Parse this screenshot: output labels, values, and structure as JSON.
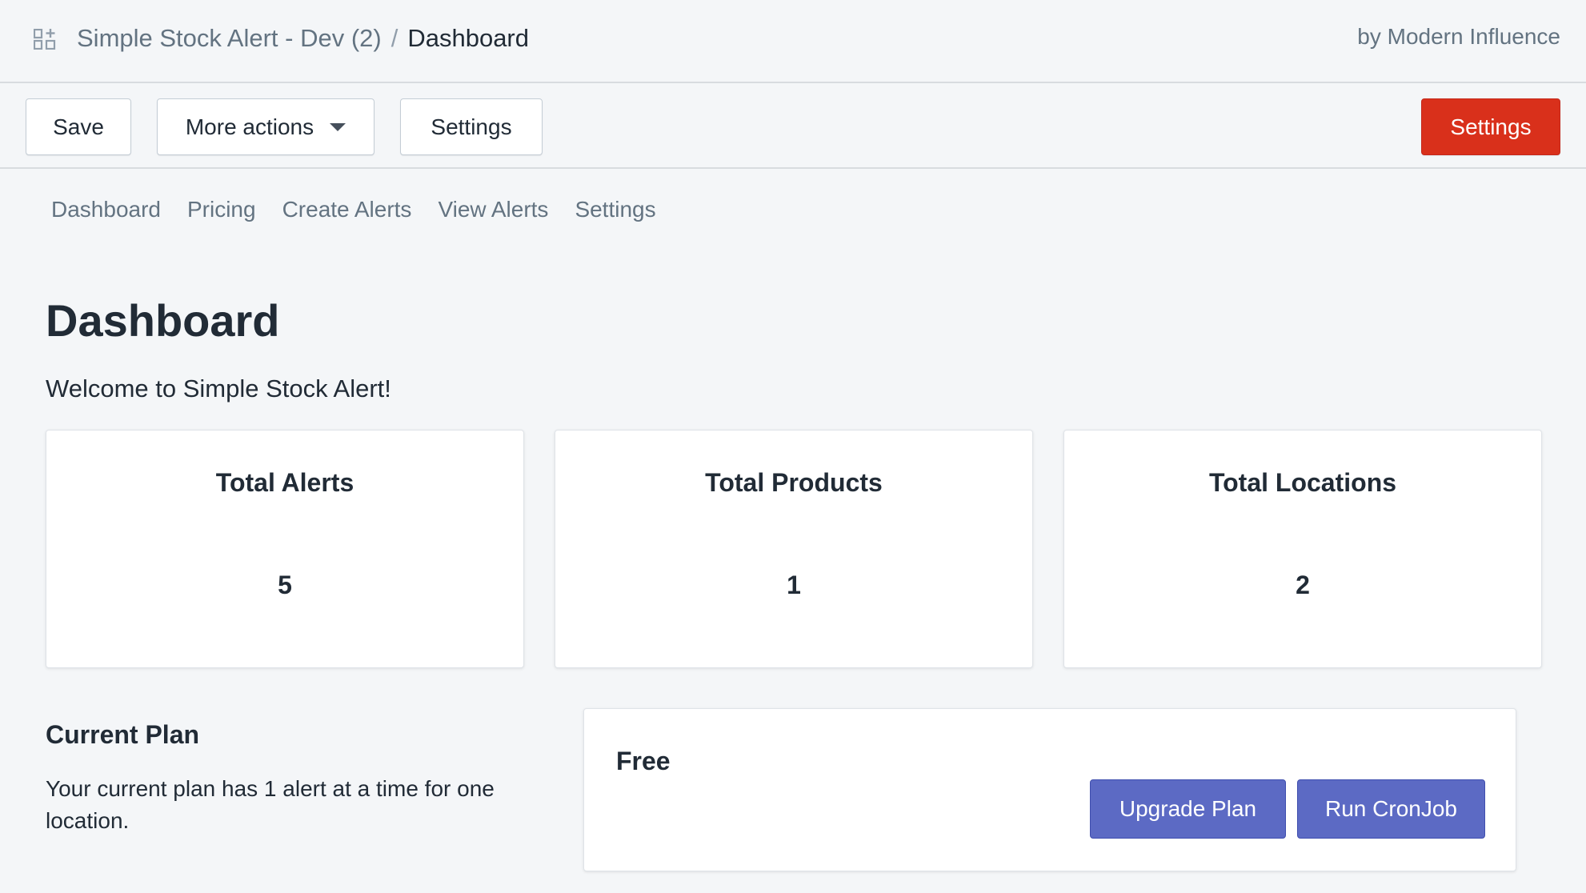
{
  "header": {
    "app_icon": "apps-grid-icon",
    "app_name": "Simple Stock Alert - Dev (2)",
    "separator": "/",
    "page_name": "Dashboard",
    "byline": "by Modern Influence"
  },
  "toolbar": {
    "save_label": "Save",
    "more_actions_label": "More actions",
    "settings_label": "Settings",
    "primary_settings_label": "Settings",
    "primary_color": "#d9301b"
  },
  "nav": {
    "items": [
      {
        "label": "Dashboard"
      },
      {
        "label": "Pricing"
      },
      {
        "label": "Create Alerts"
      },
      {
        "label": "View Alerts"
      },
      {
        "label": "Settings"
      }
    ]
  },
  "main": {
    "title": "Dashboard",
    "welcome": "Welcome to Simple Stock Alert!",
    "stats": [
      {
        "label": "Total Alerts",
        "value": "5"
      },
      {
        "label": "Total Products",
        "value": "1"
      },
      {
        "label": "Total Locations",
        "value": "2"
      }
    ],
    "plan": {
      "heading": "Current Plan",
      "description": "Your current plan has 1 alert at a time for one location.",
      "name": "Free",
      "upgrade_label": "Upgrade Plan",
      "cron_label": "Run CronJob",
      "button_color": "#5c6ac4"
    }
  }
}
